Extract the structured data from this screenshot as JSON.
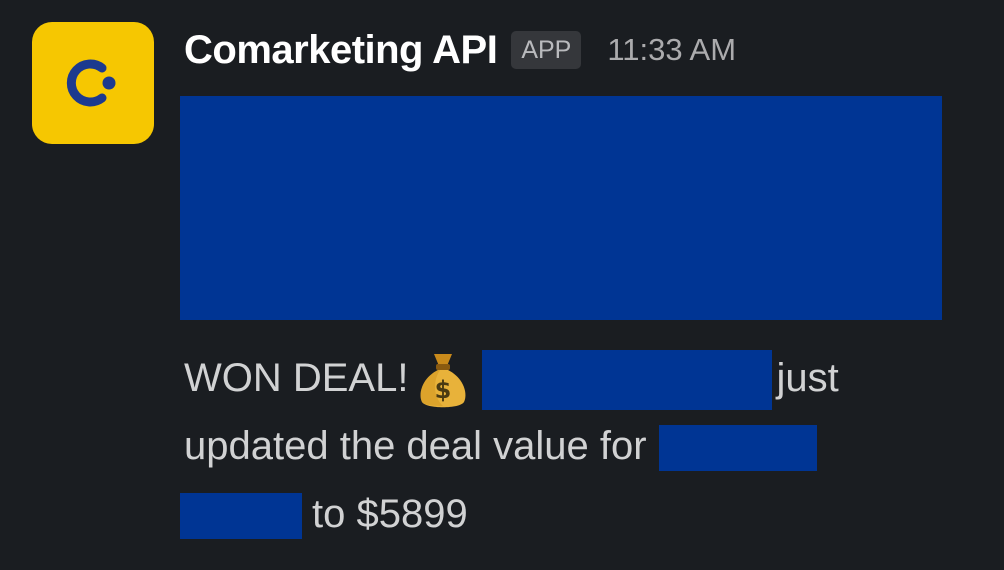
{
  "sender": {
    "name": "Comarketing API",
    "badge": "APP",
    "time": "11:33 AM",
    "avatar_color": "#f6c701",
    "avatar_icon": "comarketing-logo-icon"
  },
  "message": {
    "line1_prefix": "WON DEAL!",
    "emoji": "money-bag-icon",
    "line1_suffix": "just",
    "line2": "updated the deal value for",
    "line3_suffix": "to $5899"
  },
  "colors": {
    "background": "#1a1d21",
    "redaction": "#003594"
  }
}
